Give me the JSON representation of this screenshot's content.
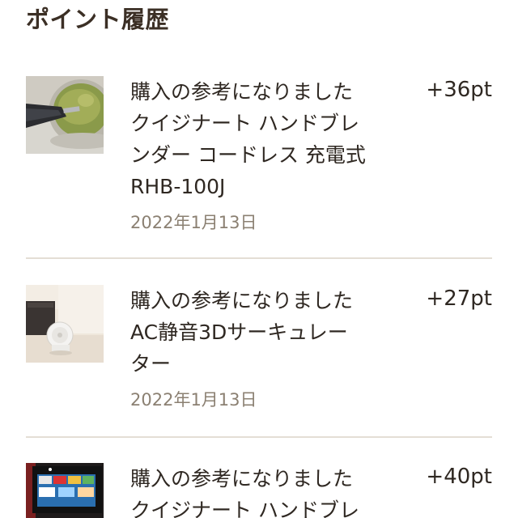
{
  "header": {
    "title": "ポイント履歴"
  },
  "history": [
    {
      "reason": "購入の参考になりました",
      "product_lines": [
        "クイジナート ハンドブレ",
        "ンダー コードレス 充電式",
        "RHB-100J"
      ],
      "date": "2022年1月13日",
      "points": "+36pt",
      "thumbnail": "hand-blender-photo"
    },
    {
      "reason": "購入の参考になりました",
      "product_lines": [
        "AC静音3Dサーキュレー",
        "ター"
      ],
      "date": "2022年1月13日",
      "points": "+27pt",
      "thumbnail": "circulator-photo"
    },
    {
      "reason": "購入の参考になりました",
      "product_lines": [
        "クイジナート ハンドブレ"
      ],
      "date": "",
      "points": "+40pt",
      "thumbnail": "tv-room-photo"
    }
  ]
}
